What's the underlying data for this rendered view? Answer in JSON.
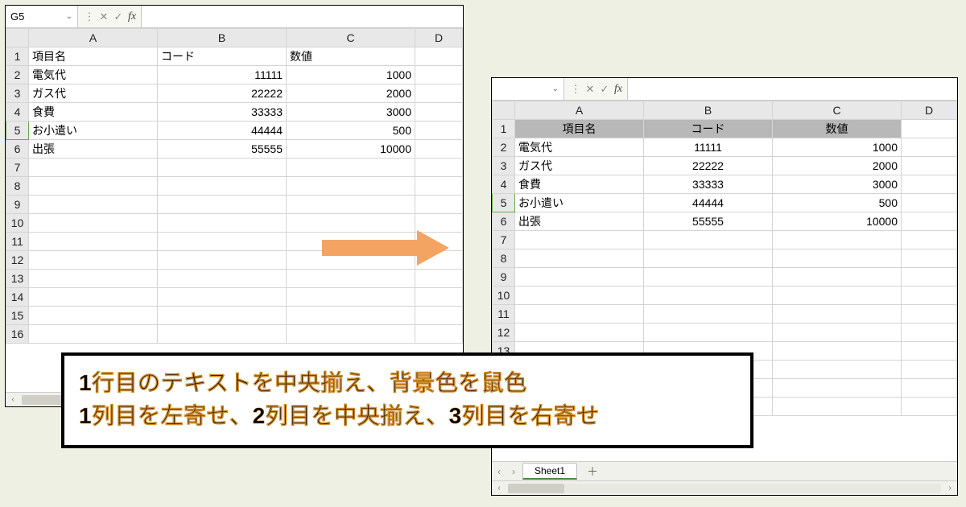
{
  "left": {
    "cellRef": "G5",
    "fx": "fx",
    "cols": [
      "A",
      "B",
      "C",
      "D"
    ],
    "header": {
      "A": "項目名",
      "B": "コード",
      "C": "数値"
    },
    "rows": [
      {
        "A": "電気代",
        "B": "11111",
        "C": "1000"
      },
      {
        "A": "ガス代",
        "B": "22222",
        "C": "2000"
      },
      {
        "A": "食費",
        "B": "33333",
        "C": "3000"
      },
      {
        "A": "お小遣い",
        "B": "44444",
        "C": "500"
      },
      {
        "A": "出張",
        "B": "55555",
        "C": "10000"
      }
    ],
    "blankRows": 10
  },
  "right": {
    "cellRef": "",
    "fx": "fx",
    "cols": [
      "A",
      "B",
      "C",
      "D"
    ],
    "header": {
      "A": "項目名",
      "B": "コード",
      "C": "数値"
    },
    "rows": [
      {
        "A": "電気代",
        "B": "11111",
        "C": "1000"
      },
      {
        "A": "ガス代",
        "B": "22222",
        "C": "2000"
      },
      {
        "A": "食費",
        "B": "33333",
        "C": "3000"
      },
      {
        "A": "お小遣い",
        "B": "44444",
        "C": "500"
      },
      {
        "A": "出張",
        "B": "55555",
        "C": "10000"
      }
    ],
    "blankRows": 10,
    "sheetTab": "Sheet1"
  },
  "caption": {
    "line1": "1行目のテキストを中央揃え、背景色を鼠色",
    "line2": "1列目を左寄せ、2列目を中央揃え、3列目を右寄せ"
  },
  "icons": {
    "dropdown": "⌄",
    "dots": "⋮",
    "cancel": "✕",
    "enter": "✓",
    "left": "‹",
    "right": "›",
    "add": "＋"
  }
}
